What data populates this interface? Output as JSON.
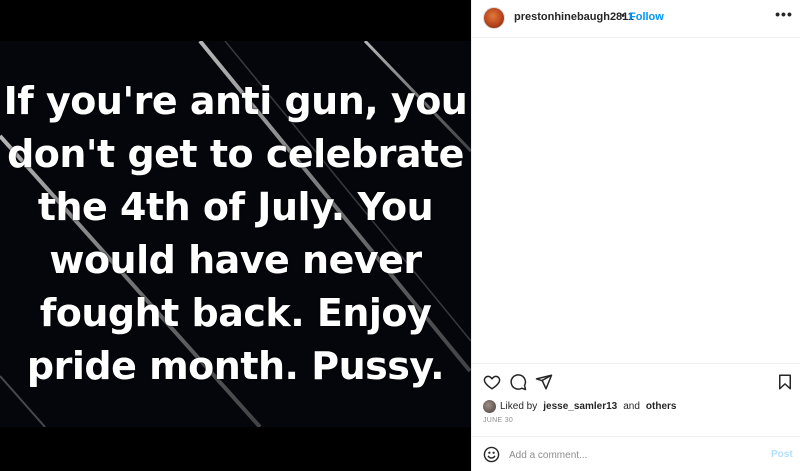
{
  "post": {
    "meme_text": "If you're anti gun, you\ndon't get to celebrate\nthe 4th of July. You\nwould have never\nfought back. Enjoy\npride month. Pussy.",
    "author": {
      "username": "prestonhinebaugh2811",
      "separator": "•",
      "follow_label": "Follow"
    },
    "more_label": "•••",
    "likes": {
      "prefix": "Liked by",
      "user": "jesse_samler13",
      "joiner": "and",
      "others": "others"
    },
    "date": "JUNE 30",
    "comment": {
      "placeholder": "Add a comment...",
      "value": "",
      "post_label": "Post"
    }
  },
  "icons": {
    "like": "heart-icon",
    "comment": "comment-icon",
    "share": "paper-plane-icon",
    "save": "bookmark-icon",
    "emoji": "smiley-icon"
  },
  "colors": {
    "accent": "#0095f6",
    "post_disabled": "#b2dffc",
    "muted": "#8e8e8e",
    "text": "#262626",
    "media_bg": "#05060c"
  }
}
